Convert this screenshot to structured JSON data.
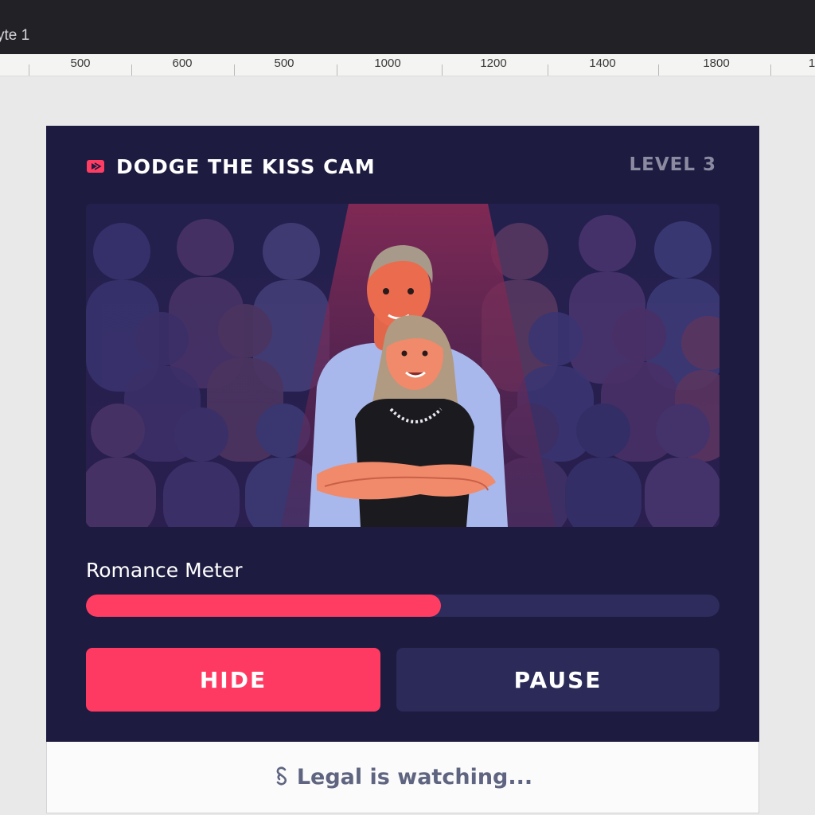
{
  "window": {
    "tab_label": "yte 1"
  },
  "ruler": {
    "labels": [
      "500",
      "600",
      "500",
      "1000",
      "1200",
      "1400",
      "1800",
      "1"
    ]
  },
  "game": {
    "title": "DODGE THE KISS CAM",
    "level": "LEVEL 3",
    "title_icon": "camera-icon",
    "accent_color": "#ff3d63",
    "panel_color": "#1d1b40"
  },
  "meter": {
    "label": "Romance Meter",
    "fill_percent": 56
  },
  "buttons": {
    "hide": "HIDE",
    "pause": "PAUSE"
  },
  "footer": {
    "text": "Legal is watching...",
    "icon": "section-icon"
  }
}
